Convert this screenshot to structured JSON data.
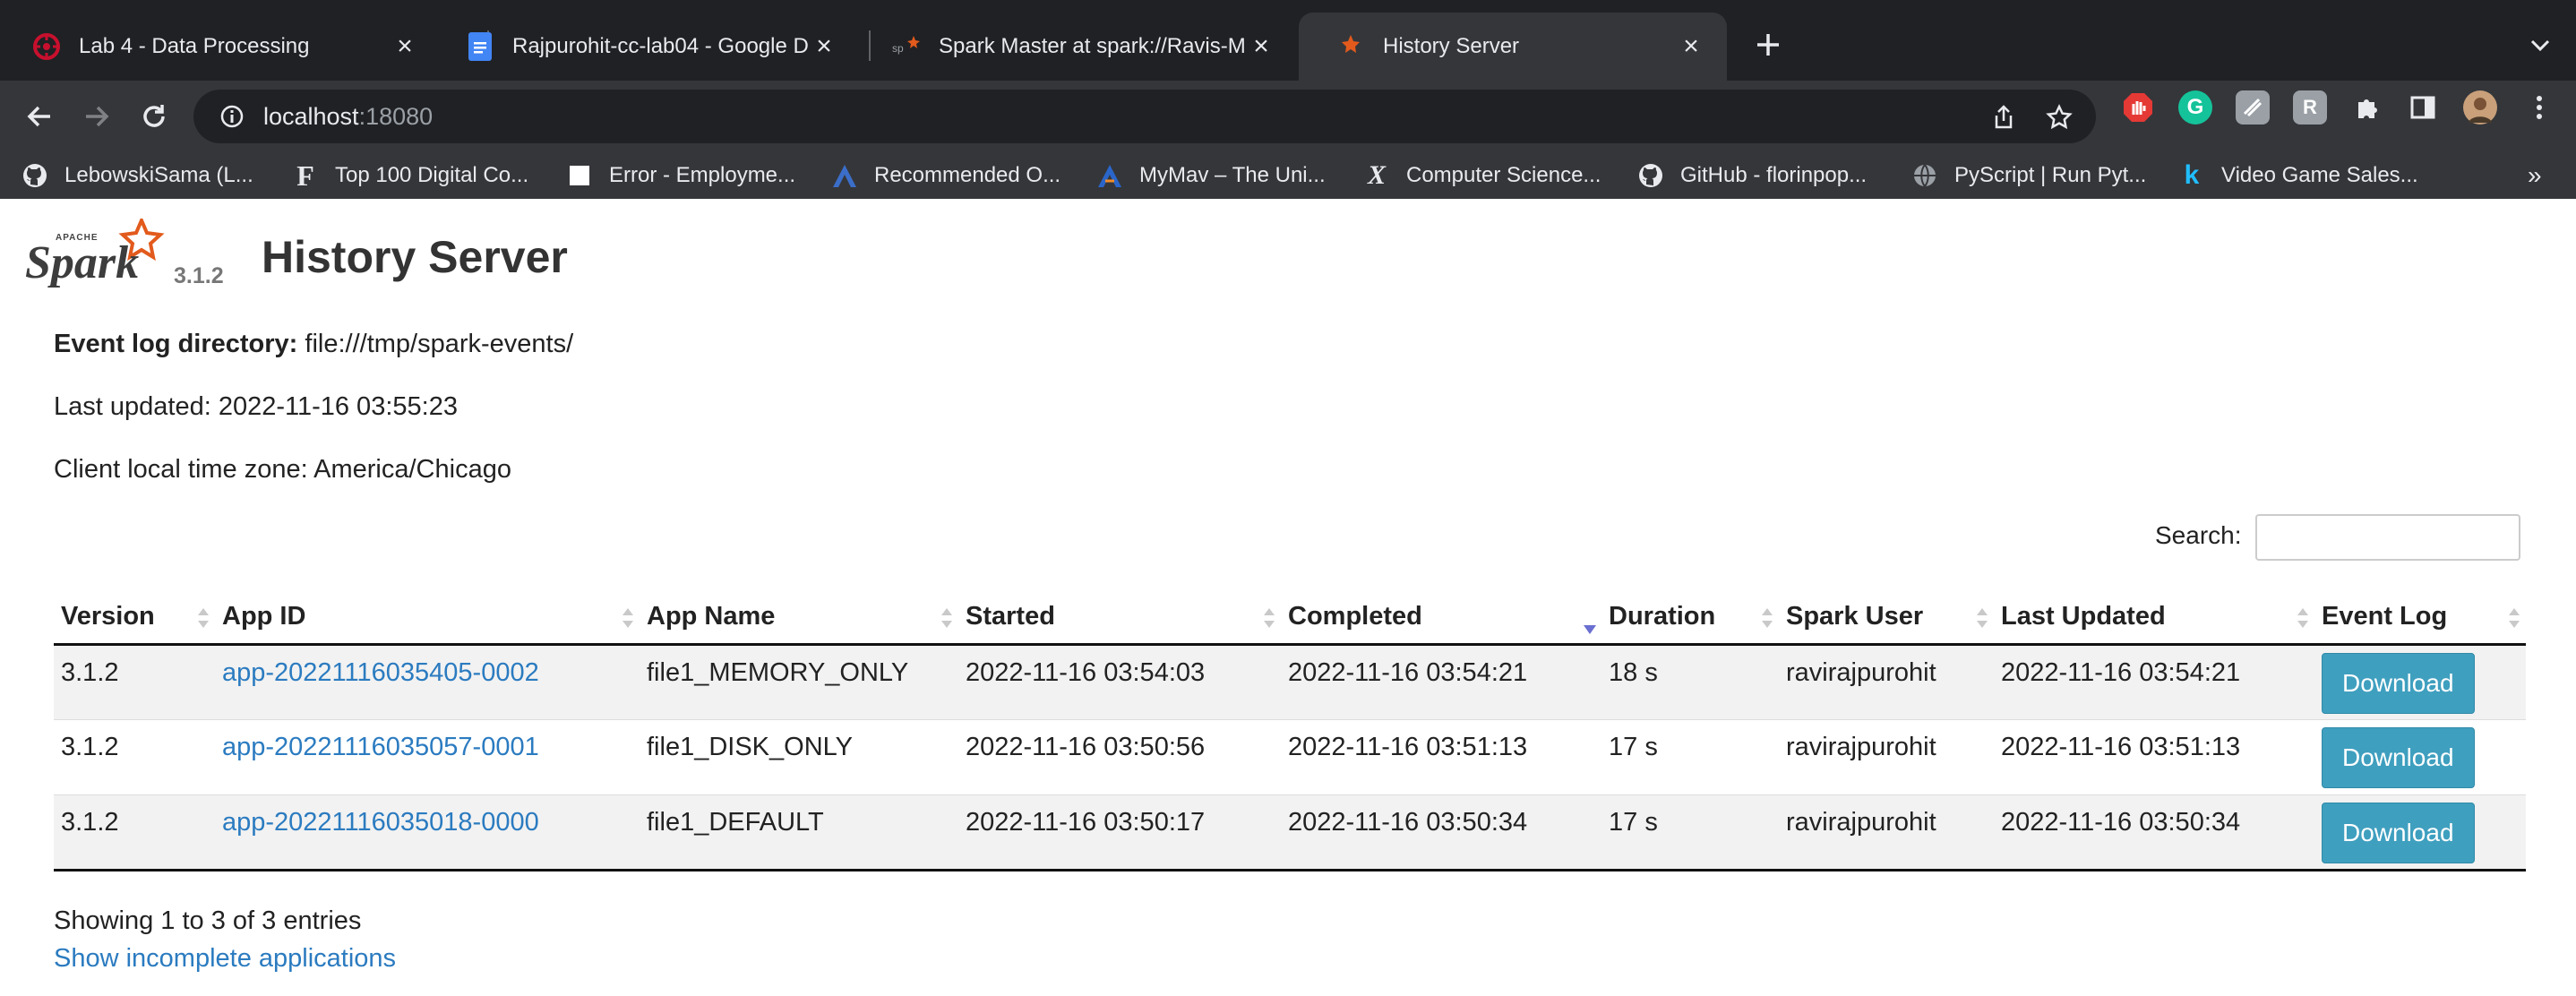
{
  "browser": {
    "tabs": [
      {
        "title": "Lab 4 - Data Processing",
        "favicon": "asu-icon"
      },
      {
        "title": "Rajpurohit-cc-lab04 - Google D",
        "favicon": "google-docs-icon"
      },
      {
        "title": "Spark Master at spark://Ravis-M",
        "favicon": "spark-icon"
      },
      {
        "title": "History Server",
        "favicon": "spark-icon",
        "active": true
      }
    ],
    "url_host": "localhost",
    "url_port": ":18080",
    "bookmarks": [
      {
        "label": "LebowskiSama (L...",
        "icon": "github-icon"
      },
      {
        "label": "Top 100 Digital Co...",
        "icon": "f-logo-icon"
      },
      {
        "label": "Error - Employme...",
        "icon": "page-icon"
      },
      {
        "label": "Recommended O...",
        "icon": "a-logo-icon"
      },
      {
        "label": "MyMav – The Uni...",
        "icon": "mymav-icon"
      },
      {
        "label": "Computer Science...",
        "icon": "x-logo-icon"
      },
      {
        "label": "GitHub - florinpop...",
        "icon": "github-icon"
      },
      {
        "label": "PyScript | Run Pyt...",
        "icon": "globe-icon"
      },
      {
        "label": "Video Game Sales...",
        "icon": "k-logo-icon"
      }
    ],
    "bookmarks_more": "»"
  },
  "page": {
    "spark_version": "3.1.2",
    "title": "History Server",
    "event_log_label": "Event log directory:",
    "event_log_value": "file:///tmp/spark-events/",
    "last_updated": "Last updated: 2022-11-16 03:55:23",
    "timezone": "Client local time zone: America/Chicago",
    "search_label": "Search:",
    "search_value": "",
    "columns": [
      "Version",
      "App ID",
      "App Name",
      "Started",
      "Completed",
      "Duration",
      "Spark User",
      "Last Updated",
      "Event Log"
    ],
    "rows": [
      {
        "version": "3.1.2",
        "app_id": "app-20221116035405-0002",
        "app_name": "file1_MEMORY_ONLY",
        "started": "2022-11-16 03:54:03",
        "completed": "2022-11-16 03:54:21",
        "duration": "18 s",
        "user": "ravirajpurohit",
        "last_updated": "2022-11-16 03:54:21",
        "event_log": "Download"
      },
      {
        "version": "3.1.2",
        "app_id": "app-20221116035057-0001",
        "app_name": "file1_DISK_ONLY",
        "started": "2022-11-16 03:50:56",
        "completed": "2022-11-16 03:51:13",
        "duration": "17 s",
        "user": "ravirajpurohit",
        "last_updated": "2022-11-16 03:51:13",
        "event_log": "Download"
      },
      {
        "version": "3.1.2",
        "app_id": "app-20221116035018-0000",
        "app_name": "file1_DEFAULT",
        "started": "2022-11-16 03:50:17",
        "completed": "2022-11-16 03:50:34",
        "duration": "17 s",
        "user": "ravirajpurohit",
        "last_updated": "2022-11-16 03:50:34",
        "event_log": "Download"
      }
    ],
    "showing": "Showing 1 to 3 of 3 entries",
    "incomplete_link": "Show incomplete applications"
  },
  "colors": {
    "link": "#2b7bc0",
    "button": "#3f9fbf",
    "chrome_dark": "#202124",
    "chrome_toolbar": "#35363a"
  }
}
